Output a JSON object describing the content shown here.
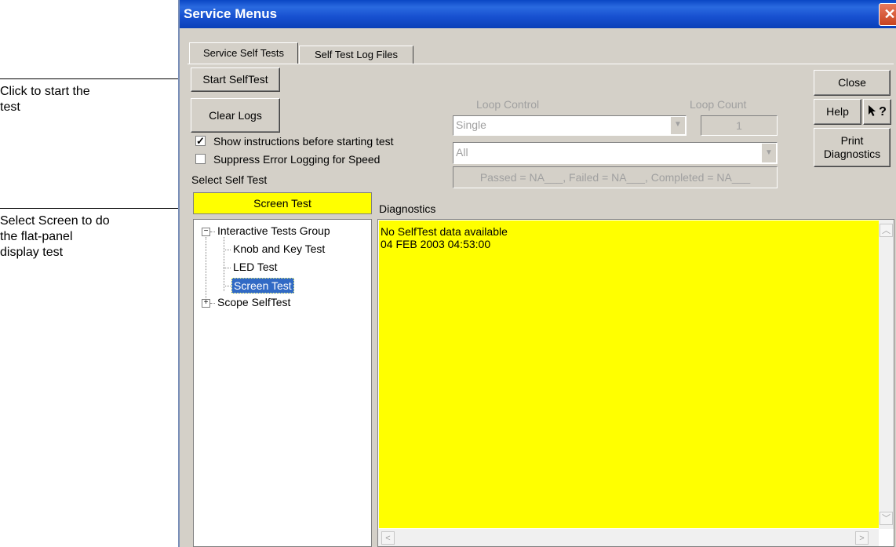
{
  "annotations": {
    "start": [
      "Click to start the",
      "test"
    ],
    "select": [
      "Select Screen to do",
      "the flat-panel",
      "display test"
    ]
  },
  "window": {
    "title": "Service Menus",
    "close_glyph": "✕"
  },
  "tabs": [
    {
      "label": "Service Self Tests",
      "active": true
    },
    {
      "label": "Self Test Log Files",
      "active": false
    }
  ],
  "buttons": {
    "start_selftest": "Start SelfTest",
    "clear_logs": "Clear Logs",
    "close": "Close",
    "help": "Help",
    "whats_this": "?",
    "print_diagnostics_line1": "Print",
    "print_diagnostics_line2": "Diagnostics"
  },
  "loop": {
    "control_label": "Loop Control",
    "control_value": "Single",
    "count_label": "Loop Count",
    "count_value": "1",
    "scope_value": "All",
    "status": "Passed = NA___, Failed = NA___, Completed = NA___"
  },
  "options": {
    "show_instructions": {
      "label": "Show instructions before starting test",
      "checked": true
    },
    "suppress_error_logging": {
      "label": "Suppress Error Logging for Speed",
      "checked": false
    }
  },
  "select_self_test": {
    "label": "Select Self Test",
    "current": "Screen Test"
  },
  "tree": {
    "groups": [
      {
        "label": "Interactive Tests Group",
        "expanded": true,
        "children": [
          "Knob and Key Test",
          "LED Test",
          "Screen Test"
        ]
      },
      {
        "label": "Scope SelfTest",
        "expanded": false,
        "children": []
      }
    ],
    "selected": "Screen Test",
    "expanded_glyph": "−",
    "collapsed_glyph": "+"
  },
  "diagnostics": {
    "label": "Diagnostics",
    "lines": [
      "No SelfTest data available",
      "04 FEB 2003 04:53:00"
    ]
  },
  "colors": {
    "title_bar": "#1750d0",
    "highlight_yellow": "#ffff00",
    "selection_blue": "#316ac5",
    "face": "#d4d0c8"
  }
}
